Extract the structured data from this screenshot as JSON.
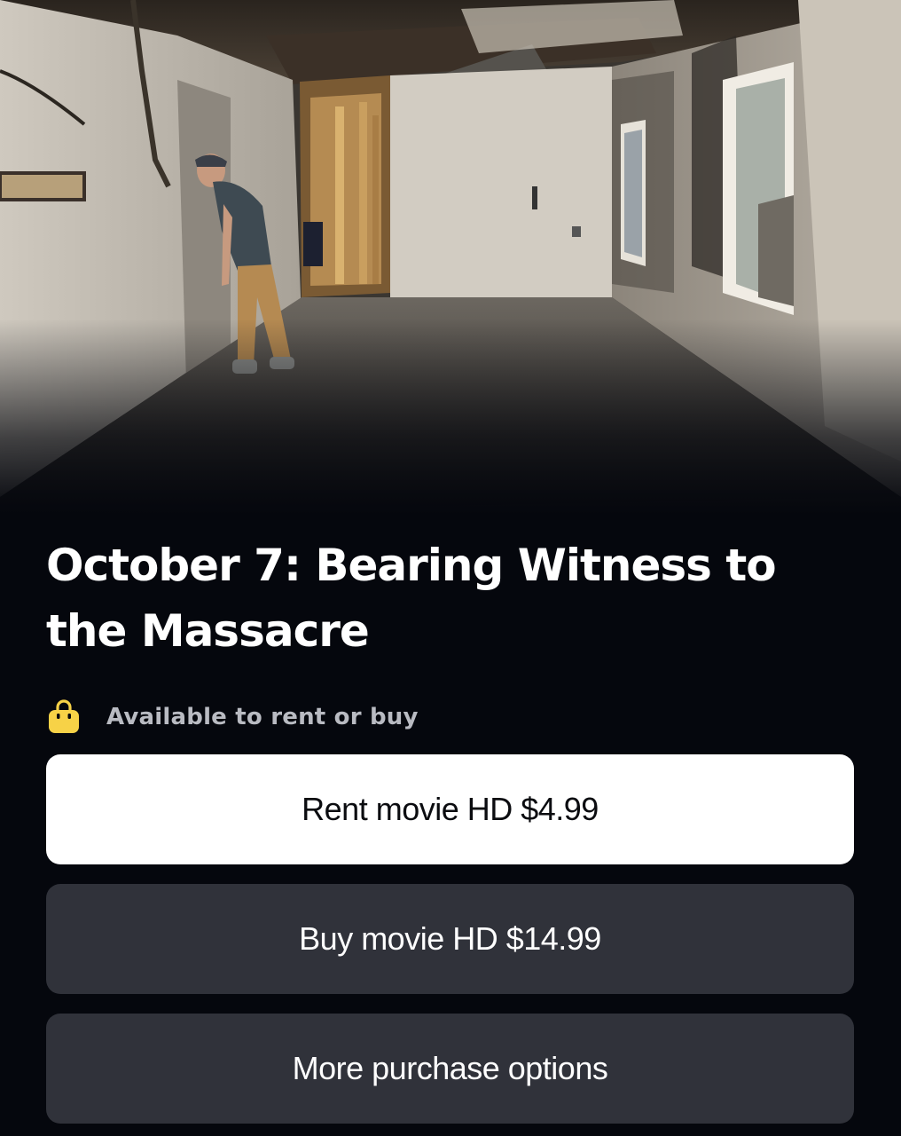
{
  "hero": {
    "image_alt": "Burned-out interior room with a man looking through a doorway"
  },
  "title": {
    "line1": "October 7: Bearing Witness to",
    "line2": "the Massacre"
  },
  "availability": {
    "icon": "shopping-bag-icon",
    "icon_color": "#f7d247",
    "text": "Available to rent or buy"
  },
  "buttons": {
    "rent_label": "Rent movie HD $4.99",
    "buy_label": "Buy movie HD $14.99",
    "more_label": "More purchase options"
  },
  "colors": {
    "background": "#05070d",
    "primary_button": "#ffffff",
    "secondary_button": "#30323a",
    "muted_text": "#b9bbc2"
  }
}
